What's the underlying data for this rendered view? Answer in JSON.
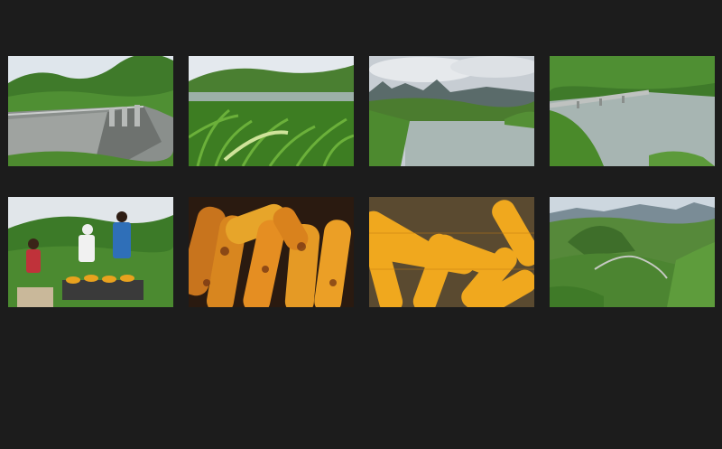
{
  "gallery": {
    "thumbnails": [
      {
        "subject": "dam-wall-and-reservoir"
      },
      {
        "subject": "corn-field-and-reservoir"
      },
      {
        "subject": "reservoir-and-mountains"
      },
      {
        "subject": "bridge-over-reservoir"
      },
      {
        "subject": "people-grilling-corn"
      },
      {
        "subject": "roasted-corn-cobs"
      },
      {
        "subject": "boiled-corn-cobs"
      },
      {
        "subject": "green-valley-road"
      }
    ]
  },
  "colors": {
    "background": "#1c1c1c",
    "sky": "#dfe6ec",
    "hill_green": "#3f7a2a",
    "water": "#a9b7b4",
    "corn": "#e8a21e",
    "roast_dark": "#6b2e12"
  }
}
